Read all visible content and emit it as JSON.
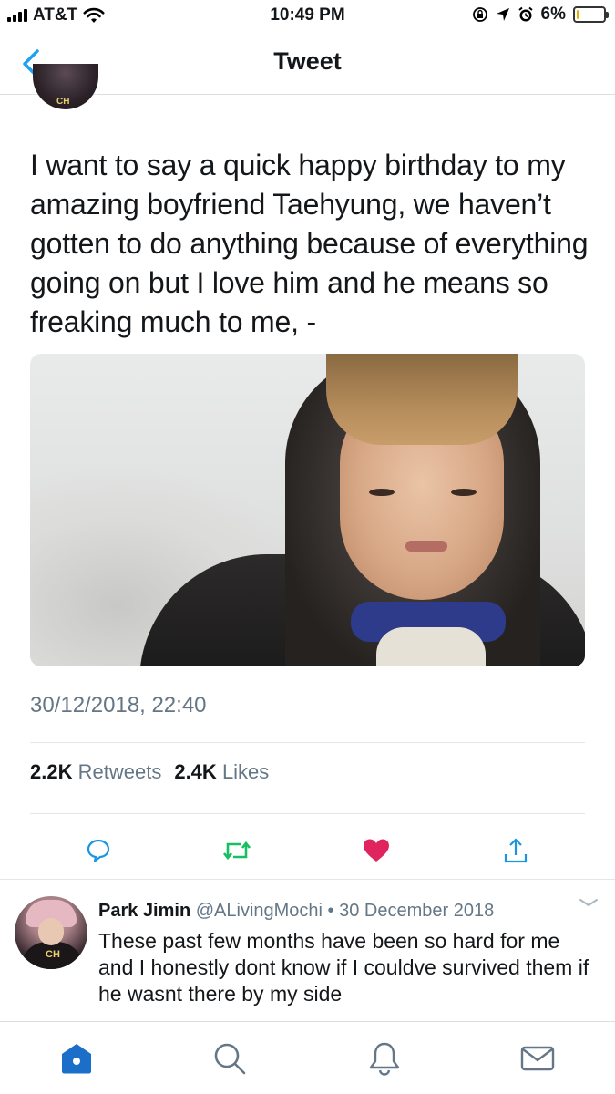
{
  "status_bar": {
    "carrier": "AT&T",
    "time": "10:49 PM",
    "battery_percent": "6%",
    "battery_level": 0.06
  },
  "nav": {
    "title": "Tweet",
    "back_icon": "chevron-left-icon"
  },
  "tweet": {
    "text": "I want to say a quick happy birthday to my amazing boyfriend Taehyung, we haven’t gotten to do anything because of everything going on but I love him and he means so freaking much to me, -",
    "timestamp": "30/12/2018, 22:40",
    "retweets_count": "2.2K",
    "retweets_label": "Retweets",
    "likes_count": "2.4K",
    "likes_label": "Likes"
  },
  "actions": {
    "reply_icon": "reply-bubble-icon",
    "retweet_icon": "retweet-icon",
    "like_icon": "heart-icon",
    "share_icon": "share-icon",
    "accent_retweet": "#17bf63",
    "accent_like": "#e0245e",
    "accent_reply": "#1b95e0"
  },
  "reply": {
    "name": "Park Jimin",
    "handle": "@ALivingMochi",
    "separator": "•",
    "date": "30 December 2018",
    "text": "These past few months have been so hard for me and I honestly dont know if I couldve survived them if he wasnt there by my side"
  },
  "tab_bar": {
    "items": [
      "home-icon",
      "search-icon",
      "notifications-icon",
      "messages-icon"
    ],
    "active_color": "#1b95e0"
  },
  "colors": {
    "accent": "#1da1f2",
    "secondary_text": "#657786"
  }
}
